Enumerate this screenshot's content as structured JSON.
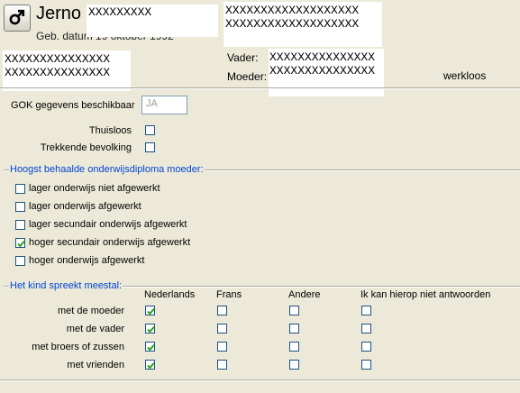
{
  "header": {
    "first_name": "Jerno",
    "name_mask": "XXXXXXXXX",
    "birth_label": "Geb. datum 19 oktober 1992",
    "addr_mask_line1": "XXXXXXXXXXXXXXXXXXX",
    "addr_mask_line2": "XXXXXXXXXXXXXXXXXXX",
    "left_mask_line1": "XXXXXXXXXXXXXXX",
    "left_mask_line2": "XXXXXXXXXXXXXXX",
    "vader_label": "Vader:",
    "moeder_label": "Moeder:",
    "parent_mask_line1": "XXXXXXXXXXXXXXX",
    "parent_mask_line2": "XXXXXXXXXXXXXXX",
    "status_text": "werkloos"
  },
  "gok": {
    "label": "GOK gegevens beschikbaar",
    "value": "JA",
    "thuisloos_label": "Thuisloos",
    "thuisloos_checked": false,
    "trekkende_label": "Trekkende bevolking",
    "trekkende_checked": false
  },
  "diploma": {
    "title": "Hoogst behaalde onderwijsdiploma moeder:",
    "options": [
      {
        "label": "lager onderwijs niet afgewerkt",
        "checked": false
      },
      {
        "label": "lager onderwijs afgewerkt",
        "checked": false
      },
      {
        "label": "lager secundair onderwijs afgewerkt",
        "checked": false
      },
      {
        "label": "hoger secundair onderwijs afgewerkt",
        "checked": true
      },
      {
        "label": "hoger onderwijs afgewerkt",
        "checked": false
      }
    ]
  },
  "language": {
    "title": "Het kind spreekt meestal:",
    "columns": [
      "Nederlands",
      "Frans",
      "Andere",
      "Ik kan hierop niet antwoorden"
    ],
    "rows": [
      {
        "label": "met de moeder",
        "checks": [
          true,
          false,
          false,
          false
        ]
      },
      {
        "label": "met de vader",
        "checks": [
          true,
          false,
          false,
          false
        ]
      },
      {
        "label": "met broers of zussen",
        "checks": [
          true,
          false,
          false,
          false
        ]
      },
      {
        "label": "met vrienden",
        "checks": [
          true,
          false,
          false,
          false
        ]
      }
    ]
  },
  "icons": {
    "gender": "male-symbol-icon",
    "check": "checkmark-icon"
  },
  "colors": {
    "background": "#ece9d8",
    "section_title": "#0046d5",
    "checkbox_border": "#1c5180",
    "checkmark": "#21a121"
  }
}
